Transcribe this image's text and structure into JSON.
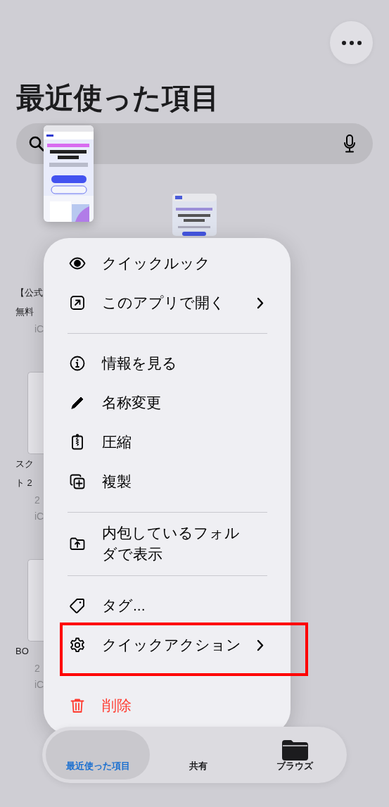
{
  "title": "最近使った項目",
  "background_files": [
    {
      "lifted": true,
      "name_lines": [
        "【公式",
        "無料"
      ],
      "details": [
        "iC"
      ]
    },
    {
      "lifted": false,
      "name_lines": [
        "スク",
        "ト 2"
      ],
      "details": [
        "2",
        "iC"
      ]
    },
    {
      "lifted": false,
      "name_lines": [
        "BO"
      ],
      "details": [
        "2",
        "iC"
      ]
    }
  ],
  "menu": {
    "sections": [
      {
        "items": [
          {
            "label": "クイックルック",
            "submenu": false,
            "destructive": false,
            "highlighted": false
          },
          {
            "label": "このアプリで開く",
            "submenu": true,
            "destructive": false,
            "highlighted": false
          }
        ]
      },
      {
        "separated": true,
        "items": [
          {
            "label": "情報を見る",
            "submenu": false,
            "destructive": false,
            "highlighted": false
          },
          {
            "label": "名称変更",
            "submenu": false,
            "destructive": false,
            "highlighted": false
          },
          {
            "label": "圧縮",
            "submenu": false,
            "destructive": false,
            "highlighted": false
          },
          {
            "label": "複製",
            "submenu": false,
            "destructive": false,
            "highlighted": false
          }
        ]
      },
      {
        "separated": true,
        "items": [
          {
            "label": "内包しているフォルダで表示",
            "submenu": false,
            "destructive": false,
            "highlighted": false
          }
        ]
      },
      {
        "separated": true,
        "items": [
          {
            "label": "タグ...",
            "submenu": false,
            "destructive": false,
            "highlighted": false
          },
          {
            "label": "クイックアクション",
            "submenu": true,
            "destructive": false,
            "highlighted": true
          }
        ]
      },
      {
        "separated": false,
        "items": [
          {
            "label": "削除",
            "submenu": false,
            "destructive": true,
            "highlighted": false
          }
        ]
      }
    ]
  },
  "tab_bar": {
    "tabs": [
      {
        "label": "最近使った項目",
        "selected": true
      },
      {
        "label": "共有",
        "selected": false
      },
      {
        "label": "ブラウズ",
        "selected": false
      }
    ]
  }
}
